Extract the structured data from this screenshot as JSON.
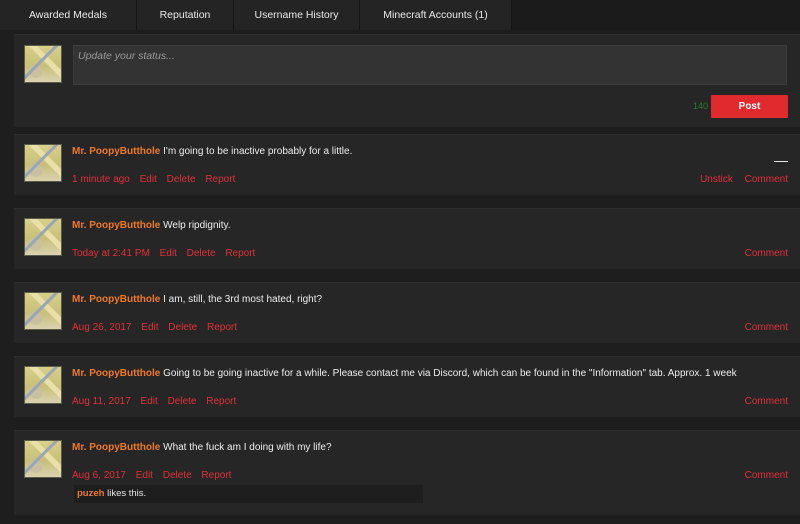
{
  "tabs": [
    "Awarded Medals",
    "Reputation",
    "Username History",
    "Minecraft Accounts (1)"
  ],
  "status": {
    "placeholder": "Update your status...",
    "counter": "140",
    "post_label": "Post"
  },
  "posts": [
    {
      "author": "Mr. PoopyButthole",
      "message": "I'm going to be inactive probably for a little.",
      "time": "1 minute ago",
      "actions_left": [
        "Edit",
        "Delete",
        "Report"
      ],
      "actions_right": [
        "Unstick",
        "Comment"
      ]
    },
    {
      "author": "Mr. PoopyButthole",
      "message": "Welp ripdignity.",
      "time": "Today at 2:41 PM",
      "actions_left": [
        "Edit",
        "Delete",
        "Report"
      ],
      "actions_right": [
        "Comment"
      ]
    },
    {
      "author": "Mr. PoopyButthole",
      "message": "I am, still, the 3rd most hated, right?",
      "time": "Aug 26, 2017",
      "actions_left": [
        "Edit",
        "Delete",
        "Report"
      ],
      "actions_right": [
        "Comment"
      ]
    },
    {
      "author": "Mr. PoopyButthole",
      "message": "Going to be going inactive for a while. Please contact me via Discord, which can be found in the \"Information\" tab. Approx. 1 week",
      "time": "Aug 11, 2017",
      "actions_left": [
        "Edit",
        "Delete",
        "Report"
      ],
      "actions_right": [
        "Comment"
      ]
    },
    {
      "author": "Mr. PoopyButthole",
      "message": "What the fuck am I doing with my life?",
      "time": "Aug 6, 2017",
      "actions_left": [
        "Edit",
        "Delete",
        "Report"
      ],
      "actions_right": [
        "Comment"
      ],
      "likes": {
        "user": "puzeh",
        "text": "likes this."
      }
    }
  ]
}
